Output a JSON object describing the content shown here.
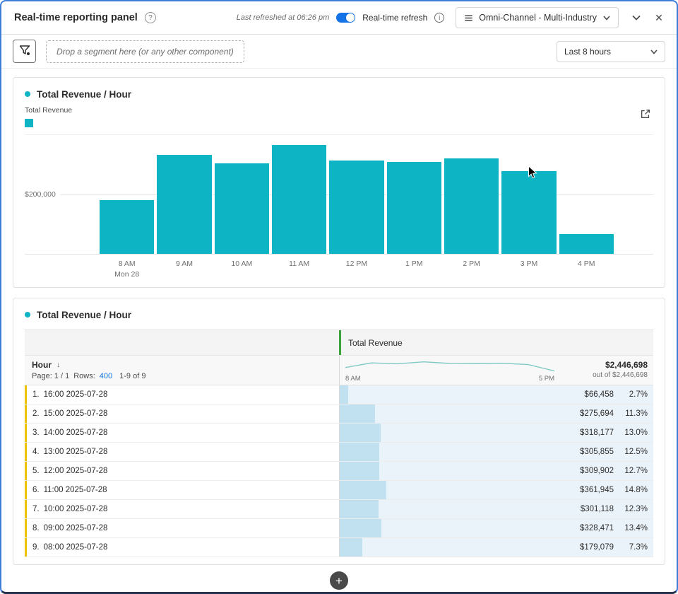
{
  "header": {
    "title": "Real-time reporting panel",
    "help_glyph": "?",
    "last_refreshed": "Last refreshed at 06:26 pm",
    "refresh_label": "Real-time refresh",
    "info_glyph": "i",
    "report_suite": "Omni-Channel - Multi-Industry",
    "close_glyph": "✕"
  },
  "filter_bar": {
    "dropzone_text": "Drop a segment here (or any other component)",
    "time_range": "Last 8 hours"
  },
  "chart_panel": {
    "title": "Total Revenue / Hour",
    "legend_label": "Total Revenue"
  },
  "chart_data": {
    "type": "bar",
    "title": "Total Revenue / Hour",
    "series_name": "Total Revenue",
    "categories": [
      "8 AM",
      "9 AM",
      "10 AM",
      "11 AM",
      "12 PM",
      "1 PM",
      "2 PM",
      "3 PM",
      "4 PM"
    ],
    "values": [
      179079,
      328471,
      301118,
      361945,
      309902,
      305855,
      318177,
      275694,
      66458
    ],
    "x_sub": {
      "index": 0,
      "label": "Mon 28"
    },
    "y_tick_label": "$200,000",
    "ylim": [
      0,
      400000
    ],
    "gridline_value": 200000,
    "legend_position": "top-left",
    "grid": "horizontal"
  },
  "table_panel": {
    "title": "Total Revenue / Hour",
    "dimension_header": "Hour",
    "sort_glyph": "↓",
    "metric_header": "Total Revenue",
    "pagination": "Page: 1 / 1",
    "rows_label": "Rows:",
    "rows_value": "400",
    "range_label": "1-9 of 9",
    "spark_start": "8 AM",
    "spark_end": "5 PM",
    "total_value": "$2,446,698",
    "total_sub": "out of $2,446,698",
    "rows": [
      {
        "num": "1.",
        "hour": "16:00 2025-07-28",
        "value": "$66,458",
        "pct": "2.7%",
        "pct_num": 2.7
      },
      {
        "num": "2.",
        "hour": "15:00 2025-07-28",
        "value": "$275,694",
        "pct": "11.3%",
        "pct_num": 11.3
      },
      {
        "num": "3.",
        "hour": "14:00 2025-07-28",
        "value": "$318,177",
        "pct": "13.0%",
        "pct_num": 13.0
      },
      {
        "num": "4.",
        "hour": "13:00 2025-07-28",
        "value": "$305,855",
        "pct": "12.5%",
        "pct_num": 12.5
      },
      {
        "num": "5.",
        "hour": "12:00 2025-07-28",
        "value": "$309,902",
        "pct": "12.7%",
        "pct_num": 12.7
      },
      {
        "num": "6.",
        "hour": "11:00 2025-07-28",
        "value": "$361,945",
        "pct": "14.8%",
        "pct_num": 14.8
      },
      {
        "num": "7.",
        "hour": "10:00 2025-07-28",
        "value": "$301,118",
        "pct": "12.3%",
        "pct_num": 12.3
      },
      {
        "num": "8.",
        "hour": "09:00 2025-07-28",
        "value": "$328,471",
        "pct": "13.4%",
        "pct_num": 13.4
      },
      {
        "num": "9.",
        "hour": "08:00 2025-07-28",
        "value": "$179,079",
        "pct": "7.3%",
        "pct_num": 7.3
      }
    ]
  },
  "add_button_glyph": "+",
  "colors": {
    "teal": "#0db5c4",
    "bar_fill_light": "#c2e1f0",
    "metric_cell_bg": "#ebf3fa",
    "row_marker_yellow": "#edc200",
    "metric_marker_green": "#3aa33a",
    "accent_blue": "#1473e6",
    "spark_line": "#7fc9c3"
  }
}
